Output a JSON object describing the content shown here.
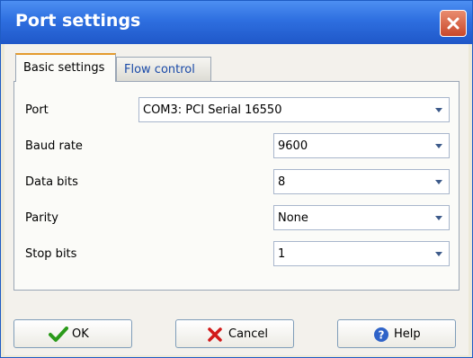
{
  "window": {
    "title": "Port settings"
  },
  "tabs": [
    {
      "label": "Basic settings",
      "selected": true
    },
    {
      "label": "Flow control",
      "selected": false
    }
  ],
  "fields": {
    "port": {
      "label": "Port",
      "value": "COM3:  PCI Serial 16550"
    },
    "baud_rate": {
      "label": "Baud rate",
      "value": "9600"
    },
    "data_bits": {
      "label": "Data bits",
      "value": "8"
    },
    "parity": {
      "label": "Parity",
      "value": "None"
    },
    "stop_bits": {
      "label": "Stop bits",
      "value": "1"
    }
  },
  "buttons": {
    "ok": {
      "label": "OK",
      "icon": "checkmark-icon"
    },
    "cancel": {
      "label": "Cancel",
      "icon": "x-icon"
    },
    "help": {
      "label": "Help",
      "icon": "help-icon"
    }
  },
  "colors": {
    "titlebar": "#2e6fe0",
    "close": "#d35a3d",
    "tab_highlight": "#e39b2e",
    "ok_icon": "#2a9a1a",
    "cancel_icon": "#d21a1a",
    "help_icon": "#2f63c8"
  }
}
